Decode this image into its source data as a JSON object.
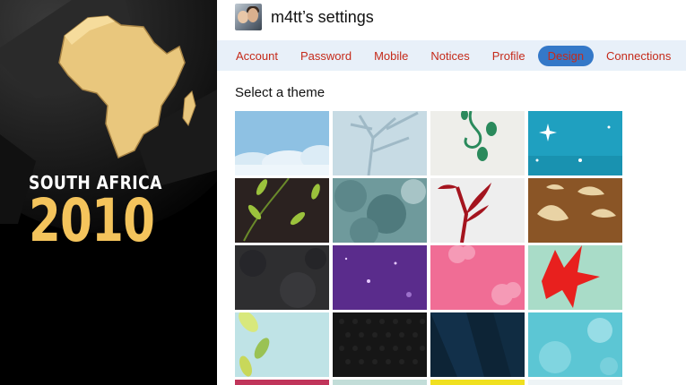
{
  "banner": {
    "subtitle": "SOUTH AFRICA",
    "year": "2010",
    "colors": {
      "gold": "#f4c45c",
      "background": "#000000"
    }
  },
  "header": {
    "title": "m4tt’s settings",
    "avatar_icon": "user-avatar"
  },
  "tabs": [
    {
      "label": "Account",
      "active": false
    },
    {
      "label": "Password",
      "active": false
    },
    {
      "label": "Mobile",
      "active": false
    },
    {
      "label": "Notices",
      "active": false
    },
    {
      "label": "Profile",
      "active": false
    },
    {
      "label": "Design",
      "active": true
    },
    {
      "label": "Connections",
      "active": false
    }
  ],
  "section": {
    "title": "Select a theme"
  },
  "themes": [
    {
      "id": "sky-clouds",
      "color": "#8ec1e3"
    },
    {
      "id": "pale-tree",
      "color": "#c7dbe4"
    },
    {
      "id": "green-vine",
      "color": "#eeeeea"
    },
    {
      "id": "teal-sparkle",
      "color": "#1fa0c0"
    },
    {
      "id": "dark-leaves",
      "color": "#2b2220"
    },
    {
      "id": "teal-foliage",
      "color": "#6f9a9c"
    },
    {
      "id": "red-branch",
      "color": "#eeeeee"
    },
    {
      "id": "brown-birds",
      "color": "#8a5526"
    },
    {
      "id": "dark-gray-texture",
      "color": "#2e2e30"
    },
    {
      "id": "purple-stars",
      "color": "#5a2c8c"
    },
    {
      "id": "pink-flowers",
      "color": "#f06d95"
    },
    {
      "id": "mint-red-leaves",
      "color": "#a9dcc8"
    },
    {
      "id": "cyan-green-leaves",
      "color": "#bfe3e6"
    },
    {
      "id": "black-mesh",
      "color": "#161616"
    },
    {
      "id": "navy-rays",
      "color": "#0d2436"
    },
    {
      "id": "aqua-bokeh",
      "color": "#5cc6d4"
    }
  ],
  "partial_row_colors": [
    "#c0355a",
    "#c2ddd8",
    "#f0e020",
    "#eef4f6"
  ]
}
